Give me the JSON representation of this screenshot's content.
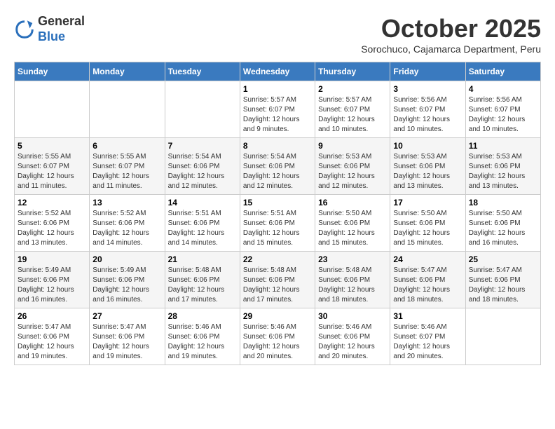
{
  "logo": {
    "general": "General",
    "blue": "Blue"
  },
  "header": {
    "month": "October 2025",
    "location": "Sorochuco, Cajamarca Department, Peru"
  },
  "weekdays": [
    "Sunday",
    "Monday",
    "Tuesday",
    "Wednesday",
    "Thursday",
    "Friday",
    "Saturday"
  ],
  "weeks": [
    [
      {
        "day": "",
        "sunrise": "",
        "sunset": "",
        "daylight": ""
      },
      {
        "day": "",
        "sunrise": "",
        "sunset": "",
        "daylight": ""
      },
      {
        "day": "",
        "sunrise": "",
        "sunset": "",
        "daylight": ""
      },
      {
        "day": "1",
        "sunrise": "Sunrise: 5:57 AM",
        "sunset": "Sunset: 6:07 PM",
        "daylight": "Daylight: 12 hours and 9 minutes."
      },
      {
        "day": "2",
        "sunrise": "Sunrise: 5:57 AM",
        "sunset": "Sunset: 6:07 PM",
        "daylight": "Daylight: 12 hours and 10 minutes."
      },
      {
        "day": "3",
        "sunrise": "Sunrise: 5:56 AM",
        "sunset": "Sunset: 6:07 PM",
        "daylight": "Daylight: 12 hours and 10 minutes."
      },
      {
        "day": "4",
        "sunrise": "Sunrise: 5:56 AM",
        "sunset": "Sunset: 6:07 PM",
        "daylight": "Daylight: 12 hours and 10 minutes."
      }
    ],
    [
      {
        "day": "5",
        "sunrise": "Sunrise: 5:55 AM",
        "sunset": "Sunset: 6:07 PM",
        "daylight": "Daylight: 12 hours and 11 minutes."
      },
      {
        "day": "6",
        "sunrise": "Sunrise: 5:55 AM",
        "sunset": "Sunset: 6:07 PM",
        "daylight": "Daylight: 12 hours and 11 minutes."
      },
      {
        "day": "7",
        "sunrise": "Sunrise: 5:54 AM",
        "sunset": "Sunset: 6:06 PM",
        "daylight": "Daylight: 12 hours and 12 minutes."
      },
      {
        "day": "8",
        "sunrise": "Sunrise: 5:54 AM",
        "sunset": "Sunset: 6:06 PM",
        "daylight": "Daylight: 12 hours and 12 minutes."
      },
      {
        "day": "9",
        "sunrise": "Sunrise: 5:53 AM",
        "sunset": "Sunset: 6:06 PM",
        "daylight": "Daylight: 12 hours and 12 minutes."
      },
      {
        "day": "10",
        "sunrise": "Sunrise: 5:53 AM",
        "sunset": "Sunset: 6:06 PM",
        "daylight": "Daylight: 12 hours and 13 minutes."
      },
      {
        "day": "11",
        "sunrise": "Sunrise: 5:53 AM",
        "sunset": "Sunset: 6:06 PM",
        "daylight": "Daylight: 12 hours and 13 minutes."
      }
    ],
    [
      {
        "day": "12",
        "sunrise": "Sunrise: 5:52 AM",
        "sunset": "Sunset: 6:06 PM",
        "daylight": "Daylight: 12 hours and 13 minutes."
      },
      {
        "day": "13",
        "sunrise": "Sunrise: 5:52 AM",
        "sunset": "Sunset: 6:06 PM",
        "daylight": "Daylight: 12 hours and 14 minutes."
      },
      {
        "day": "14",
        "sunrise": "Sunrise: 5:51 AM",
        "sunset": "Sunset: 6:06 PM",
        "daylight": "Daylight: 12 hours and 14 minutes."
      },
      {
        "day": "15",
        "sunrise": "Sunrise: 5:51 AM",
        "sunset": "Sunset: 6:06 PM",
        "daylight": "Daylight: 12 hours and 15 minutes."
      },
      {
        "day": "16",
        "sunrise": "Sunrise: 5:50 AM",
        "sunset": "Sunset: 6:06 PM",
        "daylight": "Daylight: 12 hours and 15 minutes."
      },
      {
        "day": "17",
        "sunrise": "Sunrise: 5:50 AM",
        "sunset": "Sunset: 6:06 PM",
        "daylight": "Daylight: 12 hours and 15 minutes."
      },
      {
        "day": "18",
        "sunrise": "Sunrise: 5:50 AM",
        "sunset": "Sunset: 6:06 PM",
        "daylight": "Daylight: 12 hours and 16 minutes."
      }
    ],
    [
      {
        "day": "19",
        "sunrise": "Sunrise: 5:49 AM",
        "sunset": "Sunset: 6:06 PM",
        "daylight": "Daylight: 12 hours and 16 minutes."
      },
      {
        "day": "20",
        "sunrise": "Sunrise: 5:49 AM",
        "sunset": "Sunset: 6:06 PM",
        "daylight": "Daylight: 12 hours and 16 minutes."
      },
      {
        "day": "21",
        "sunrise": "Sunrise: 5:48 AM",
        "sunset": "Sunset: 6:06 PM",
        "daylight": "Daylight: 12 hours and 17 minutes."
      },
      {
        "day": "22",
        "sunrise": "Sunrise: 5:48 AM",
        "sunset": "Sunset: 6:06 PM",
        "daylight": "Daylight: 12 hours and 17 minutes."
      },
      {
        "day": "23",
        "sunrise": "Sunrise: 5:48 AM",
        "sunset": "Sunset: 6:06 PM",
        "daylight": "Daylight: 12 hours and 18 minutes."
      },
      {
        "day": "24",
        "sunrise": "Sunrise: 5:47 AM",
        "sunset": "Sunset: 6:06 PM",
        "daylight": "Daylight: 12 hours and 18 minutes."
      },
      {
        "day": "25",
        "sunrise": "Sunrise: 5:47 AM",
        "sunset": "Sunset: 6:06 PM",
        "daylight": "Daylight: 12 hours and 18 minutes."
      }
    ],
    [
      {
        "day": "26",
        "sunrise": "Sunrise: 5:47 AM",
        "sunset": "Sunset: 6:06 PM",
        "daylight": "Daylight: 12 hours and 19 minutes."
      },
      {
        "day": "27",
        "sunrise": "Sunrise: 5:47 AM",
        "sunset": "Sunset: 6:06 PM",
        "daylight": "Daylight: 12 hours and 19 minutes."
      },
      {
        "day": "28",
        "sunrise": "Sunrise: 5:46 AM",
        "sunset": "Sunset: 6:06 PM",
        "daylight": "Daylight: 12 hours and 19 minutes."
      },
      {
        "day": "29",
        "sunrise": "Sunrise: 5:46 AM",
        "sunset": "Sunset: 6:06 PM",
        "daylight": "Daylight: 12 hours and 20 minutes."
      },
      {
        "day": "30",
        "sunrise": "Sunrise: 5:46 AM",
        "sunset": "Sunset: 6:06 PM",
        "daylight": "Daylight: 12 hours and 20 minutes."
      },
      {
        "day": "31",
        "sunrise": "Sunrise: 5:46 AM",
        "sunset": "Sunset: 6:07 PM",
        "daylight": "Daylight: 12 hours and 20 minutes."
      },
      {
        "day": "",
        "sunrise": "",
        "sunset": "",
        "daylight": ""
      }
    ]
  ]
}
